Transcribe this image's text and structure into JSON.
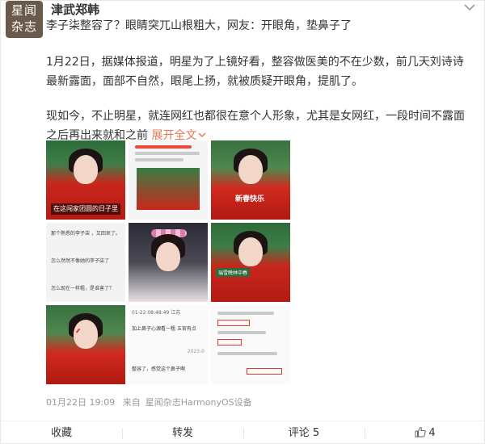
{
  "header": {
    "avatar_text": "星闻杂志",
    "user_name": "津武郑韩",
    "more_icon": "chevron-down-icon"
  },
  "post": {
    "title": "李子柒整容了？眼睛突兀山根粗大，网友：开眼角，垫鼻子了",
    "para1": "1月22日，据媒体报道，明星为了上镜好看，整容做医美的不在少数，前几天刘诗诗最新露面，面部不自然，眼尾上扬，就被质疑开眼角，提肌了。",
    "para2": "现如今，不止明星，就连网红也都很在意个人形象，尤其是女网红，一段时间不露面之后再出来就和之前",
    "expand": "展开全文",
    "expand_icon": "chevron-down-icon"
  },
  "images": {
    "img1_caption": "在这闯家团圆的日子里",
    "img3_caption": "新春快乐",
    "img6_caption": "瑞雪晚林中春",
    "img8_time": "01-22 08:48:49 江苏",
    "img8_line1": "加上鼻子心源看一粗 五官有点",
    "img8_line2": "2023-0",
    "img8_line3": "整容了，感觉这个鼻子啊",
    "img4_line1": "那个熟悉的李子柒 ，又回来了。",
    "img4_line2": "怎么然然不像她的李子柒了",
    "img4_line3": "怎么现在一样粗，是谁害了？"
  },
  "meta": {
    "date": "01月22日 19:09",
    "source_prefix": "来自",
    "source": "星闻杂志HarmonyOS设备"
  },
  "actions": {
    "favorite": "收藏",
    "repost": "转发",
    "comment": "评论 5",
    "like_icon": "thumbs-up-icon",
    "like_count": "4"
  },
  "colors": {
    "accent": "#eb7350",
    "text": "#333333",
    "meta": "#999999"
  }
}
